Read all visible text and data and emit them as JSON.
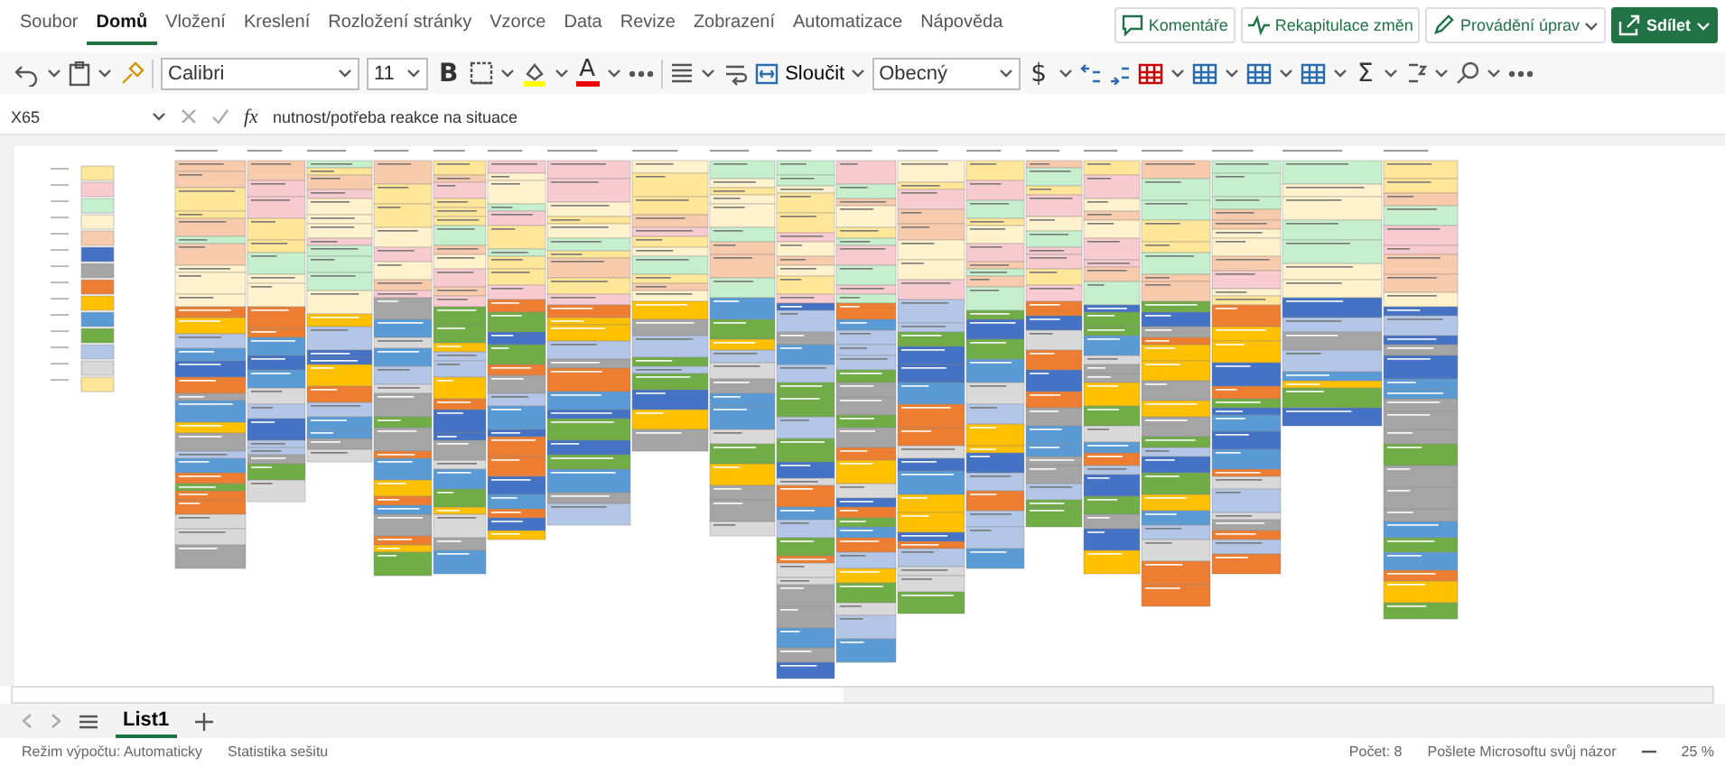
{
  "menu_tabs": [
    {
      "label": "Soubor",
      "selected": false
    },
    {
      "label": "Domů",
      "selected": true
    },
    {
      "label": "Vložení",
      "selected": false
    },
    {
      "label": "Kreslení",
      "selected": false
    },
    {
      "label": "Rozložení stránky",
      "selected": false
    },
    {
      "label": "Vzorce",
      "selected": false
    },
    {
      "label": "Data",
      "selected": false
    },
    {
      "label": "Revize",
      "selected": false
    },
    {
      "label": "Zobrazení",
      "selected": false
    },
    {
      "label": "Automatizace",
      "selected": false
    },
    {
      "label": "Nápověda",
      "selected": false
    }
  ],
  "action_buttons": [
    {
      "label": "Komentáře",
      "kind": "comment"
    },
    {
      "label": "Rekapitulace změn",
      "kind": "changes"
    },
    {
      "label": "Provádění úprav",
      "kind": "edit"
    },
    {
      "label": "Sdílet",
      "kind": "share"
    }
  ],
  "toolbar": {
    "font": "Calibri",
    "size": "11",
    "bold": "B",
    "font_color": "A",
    "merge": "Sloučit",
    "number_format": "Obecný",
    "currency": "$",
    "sum": "Σ"
  },
  "formula_bar": {
    "cell": "X65",
    "fx": "fx",
    "formula": "nutnost/potřeba reakce na situace"
  },
  "sheet_tabs": [
    {
      "label": "List1",
      "selected": true
    }
  ],
  "status_bar": {
    "calc_mode": "Režim výpočtu: Automaticky",
    "stats": "Statistika sešitu",
    "count": "Počet: 8",
    "feedback": "Pošlete Microsoftu svůj názor",
    "zoom": "25 %"
  }
}
